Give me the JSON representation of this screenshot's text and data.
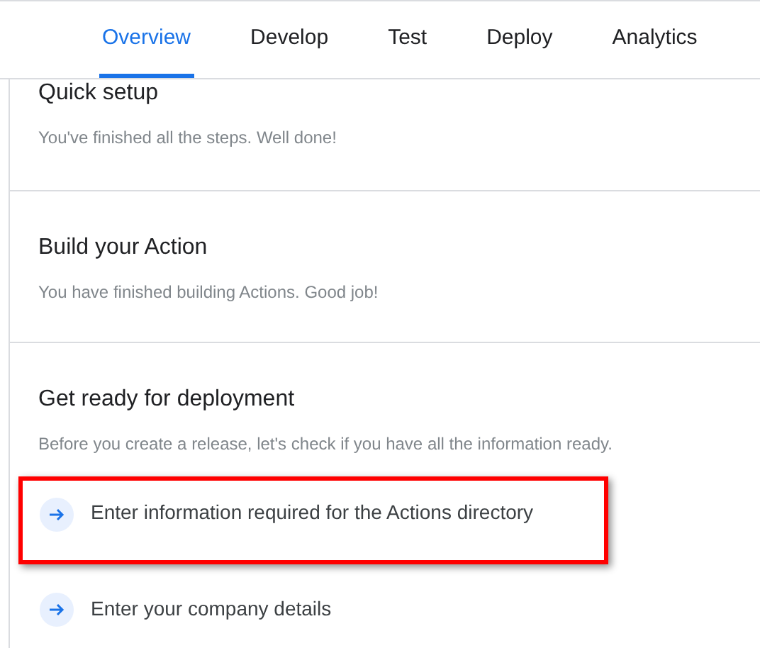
{
  "tabs": [
    {
      "label": "Overview",
      "selected": true
    },
    {
      "label": "Develop",
      "selected": false
    },
    {
      "label": "Test",
      "selected": false
    },
    {
      "label": "Deploy",
      "selected": false
    },
    {
      "label": "Analytics",
      "selected": false
    }
  ],
  "sections": [
    {
      "title": "Quick setup",
      "description": "You've finished all the steps. Well done!"
    },
    {
      "title": "Build your Action",
      "description": "You have finished building Actions. Good job!"
    },
    {
      "title": "Get ready for deployment",
      "description": "Before you create a release, let's check if you have all the information ready.",
      "tasks": [
        {
          "label": "Enter information required for the Actions directory",
          "highlighted": true
        },
        {
          "label": "Enter your company details",
          "highlighted": false
        }
      ]
    }
  ]
}
